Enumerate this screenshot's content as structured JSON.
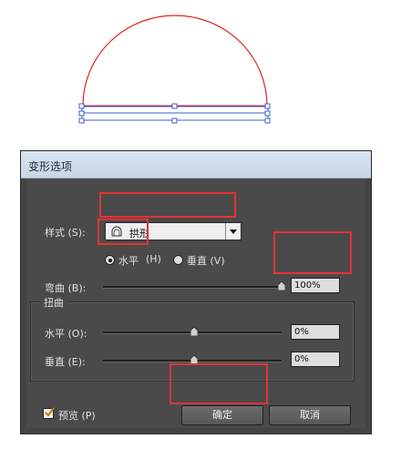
{
  "dialog": {
    "title": "变形选项",
    "style_label": "样式 (S):",
    "style_value": "拱形",
    "horizontal_label": "水平",
    "horizontal_hotkey": "(H)",
    "vertical_label": "垂直 (V)",
    "bend_label": "弯曲 (B):",
    "bend_value": "100%",
    "distortion_group": "扭曲",
    "dist_horizontal_label": "水平 (O):",
    "dist_horizontal_value": "0%",
    "dist_vertical_label": "垂直 (E):",
    "dist_vertical_value": "0%",
    "preview_label": "预览 (P)",
    "ok_label": "确定",
    "cancel_label": "取消"
  },
  "colors": {
    "highlight": "#e53333",
    "arc": "#e02020",
    "selection": "#3366cc"
  },
  "icons": {
    "style_icon": "arch-icon",
    "dropdown_arrow": "chevron-down-icon",
    "check": "check-icon"
  }
}
